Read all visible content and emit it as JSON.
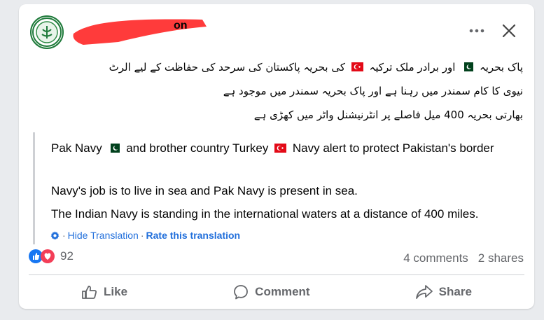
{
  "post": {
    "author_name_visible": "on",
    "urdu_lines": [
      {
        "part_a": "پاک بحریہ",
        "part_b": "اور برادر ملک ترکیہ",
        "part_c": "کی بحریہ پاکستان کی سرحد کی حفاظت کے لیے الرٹ"
      },
      {
        "text": "نیوی کا کام سمندر میں رہنا ہے اور پاک بحریہ سمندر میں موجود ہے"
      },
      {
        "text": "بھارتی بحریہ 400 میل فاصلے پر انٹرنیشنل واٹر میں کھڑی ہے"
      }
    ],
    "translation": {
      "line1_a": "Pak Navy",
      "line1_b": "and brother country Turkey",
      "line1_c": "Navy alert to protect Pakistan's border",
      "line2": "Navy's job is to live in sea and Pak Navy is present in sea.",
      "line3": "The Indian Navy is standing in the international waters at a distance of 400 miles.",
      "hide_label": "Hide Translation",
      "rate_label": "Rate this translation"
    }
  },
  "reactions": {
    "count": "92"
  },
  "stats": {
    "comments": "4 comments",
    "shares": "2 shares"
  },
  "actions": {
    "like": "Like",
    "comment": "Comment",
    "share": "Share"
  },
  "colors": {
    "accent": "#216fdb",
    "muted": "#65676b",
    "pk_green": "#01411c",
    "tr_red": "#e30a17",
    "redaction": "#ff3b3b"
  }
}
